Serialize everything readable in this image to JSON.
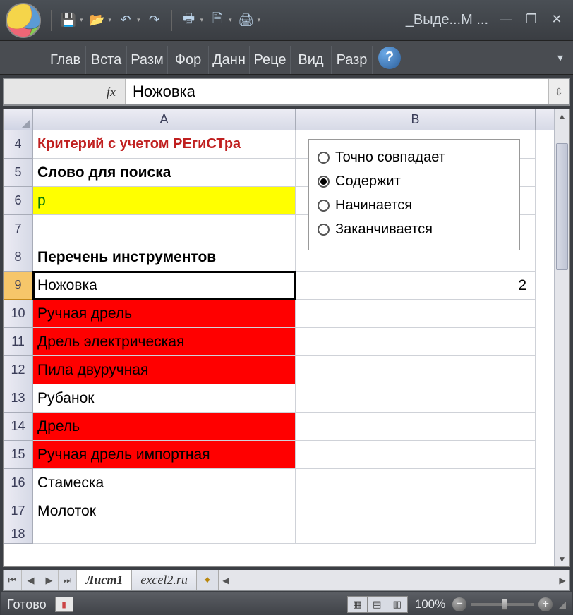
{
  "window": {
    "title": "_Выде...M ..."
  },
  "qat": {
    "save_icon": "save-icon",
    "open_icon": "open-icon",
    "undo_icon": "undo-icon",
    "redo_icon": "redo-icon",
    "qprint_icon": "quickprint-icon",
    "preview_icon": "preview-icon",
    "print_icon": "print-icon"
  },
  "ribbon": {
    "tabs": [
      "Глав",
      "Вста",
      "Разм",
      "Фор",
      "Данн",
      "Реце",
      "Вид",
      "Разр"
    ],
    "help": "?"
  },
  "formula_bar": {
    "fx": "fx",
    "value": "Ножовка"
  },
  "columns": [
    "A",
    "B"
  ],
  "rows": [
    {
      "n": 4,
      "a": "Критерий с учетом РЕгиСТра",
      "a_style": "redtxt",
      "b": ""
    },
    {
      "n": 5,
      "a": "Слово для поиска",
      "a_style": "bold",
      "b": ""
    },
    {
      "n": 6,
      "a": "р",
      "a_style": "yellow",
      "b": ""
    },
    {
      "n": 7,
      "a": "",
      "b": ""
    },
    {
      "n": 8,
      "a": "Перечень инструментов",
      "a_style": "bold",
      "b": ""
    },
    {
      "n": 9,
      "a": "Ножовка",
      "a_style": "active",
      "b": "2"
    },
    {
      "n": 10,
      "a": "Ручная дрель",
      "a_style": "red",
      "b": ""
    },
    {
      "n": 11,
      "a": "Дрель электрическая",
      "a_style": "red",
      "b": ""
    },
    {
      "n": 12,
      "a": "Пила двуручная",
      "a_style": "red",
      "b": ""
    },
    {
      "n": 13,
      "a": "Рубанок",
      "b": ""
    },
    {
      "n": 14,
      "a": "Дрель",
      "a_style": "red",
      "b": ""
    },
    {
      "n": 15,
      "a": "Ручная дрель импортная",
      "a_style": "red",
      "b": ""
    },
    {
      "n": 16,
      "a": "Стамеска",
      "b": ""
    },
    {
      "n": 17,
      "a": "Молоток",
      "b": ""
    },
    {
      "n": 18,
      "a": "",
      "b": ""
    }
  ],
  "radio": {
    "options": [
      "Точно совпадает",
      "Содержит",
      "Начинается",
      "Заканчивается"
    ],
    "selected": 1
  },
  "sheets": {
    "tabs": [
      "Лист1",
      "excel2.ru"
    ],
    "active": 0
  },
  "status": {
    "ready": "Готово",
    "zoom": "100%"
  }
}
